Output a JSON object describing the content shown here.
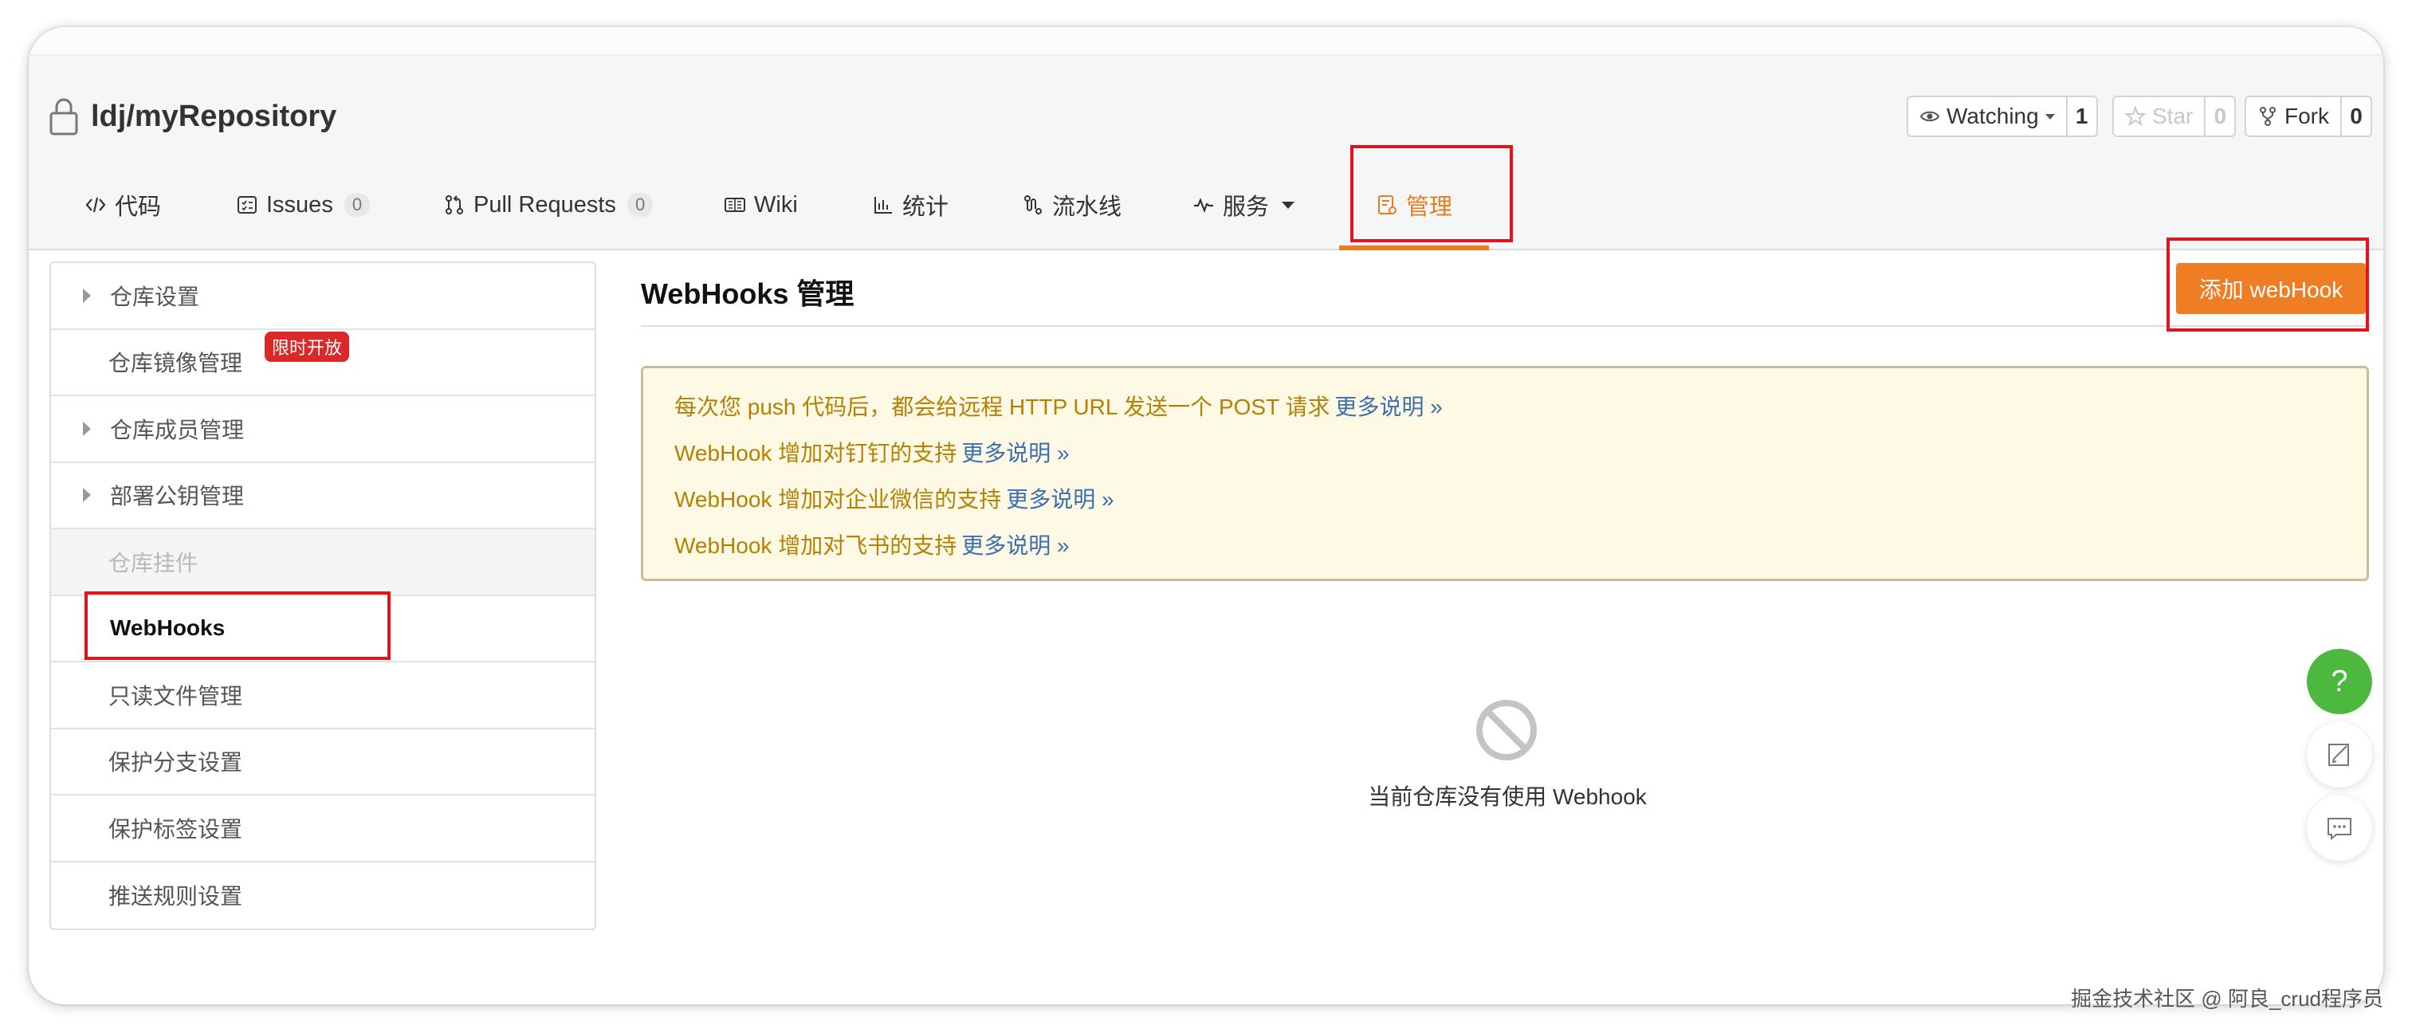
{
  "repo": {
    "name": "ldj/myRepository"
  },
  "actions": {
    "watch": {
      "label": "Watching",
      "count": "1"
    },
    "star": {
      "label": "Star",
      "count": "0"
    },
    "fork": {
      "label": "Fork",
      "count": "0"
    }
  },
  "tabs": [
    {
      "label": "代码",
      "icon": "code-icon"
    },
    {
      "label": "Issues",
      "badge": "0",
      "icon": "issues-icon"
    },
    {
      "label": "Pull Requests",
      "badge": "0",
      "icon": "pull-request-icon"
    },
    {
      "label": "Wiki",
      "icon": "book-icon"
    },
    {
      "label": "统计",
      "icon": "bar-chart-icon"
    },
    {
      "label": "流水线",
      "icon": "pipeline-icon"
    },
    {
      "label": "服务",
      "icon": "pulse-icon"
    },
    {
      "label": "管理",
      "icon": "manage-icon",
      "active": true
    }
  ],
  "sidebar": {
    "items": [
      {
        "label": "仓库设置"
      },
      {
        "label": "仓库镜像管理",
        "tag": "限时开放"
      },
      {
        "label": "仓库成员管理"
      },
      {
        "label": "部署公钥管理"
      },
      {
        "label": "仓库挂件"
      },
      {
        "label": "WebHooks"
      },
      {
        "label": "只读文件管理"
      },
      {
        "label": "保护分支设置"
      },
      {
        "label": "保护标签设置"
      },
      {
        "label": "推送规则设置"
      }
    ]
  },
  "main": {
    "title": "WebHooks 管理",
    "add_button": "添加 webHook",
    "notice": [
      {
        "text": "每次您 push 代码后，都会给远程 HTTP URL 发送一个 POST 请求",
        "link": "更多说明 »"
      },
      {
        "text": "WebHook 增加对钉钉的支持",
        "link": "更多说明 »"
      },
      {
        "text": "WebHook 增加对企业微信的支持",
        "link": "更多说明 »"
      },
      {
        "text": "WebHook 增加对飞书的支持",
        "link": "更多说明 »"
      }
    ],
    "empty_text": "当前仓库没有使用 Webhook"
  },
  "float": {
    "help": "?"
  },
  "watermark": "掘金技术社区 @ 阿良_crud程序员",
  "colors": {
    "accent": "#ef7d23",
    "highlight": "#e0141c",
    "help": "#4db83e",
    "tag": "#db2828"
  }
}
